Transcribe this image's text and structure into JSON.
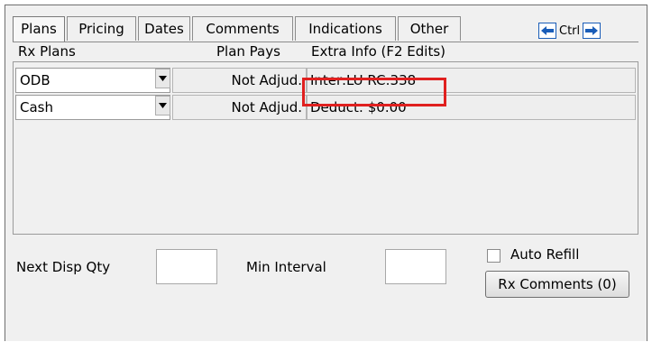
{
  "tabs": [
    {
      "label": "Plans",
      "active": true
    },
    {
      "label": "Pricing"
    },
    {
      "label": "Dates"
    },
    {
      "label": "Comments"
    },
    {
      "label": "Indications"
    },
    {
      "label": "Other"
    }
  ],
  "nav": {
    "ctrl_label": "Ctrl",
    "prev_icon": "arrow-left-icon",
    "next_icon": "arrow-right-icon"
  },
  "headers": {
    "rx_plans": "Rx Plans",
    "plan_pays": "Plan Pays",
    "extra_info": "Extra Info (F2 Edits)"
  },
  "plans": [
    {
      "plan": "ODB",
      "pays": "Not Adjud.",
      "extra": "Inter:LU RC:338"
    },
    {
      "plan": "Cash",
      "pays": "Not Adjud.",
      "extra": "Deduct: $0.00"
    }
  ],
  "bottom": {
    "next_disp_qty_label": "Next Disp Qty",
    "next_disp_qty_value": "",
    "min_interval_label": "Min Interval",
    "min_interval_value": "",
    "auto_refill_label": "Auto Refill",
    "auto_refill_checked": false,
    "rx_comments_label": "Rx Comments (0)"
  },
  "colors": {
    "highlight": "#e0201f",
    "nav_arrow": "#1a5db8"
  }
}
